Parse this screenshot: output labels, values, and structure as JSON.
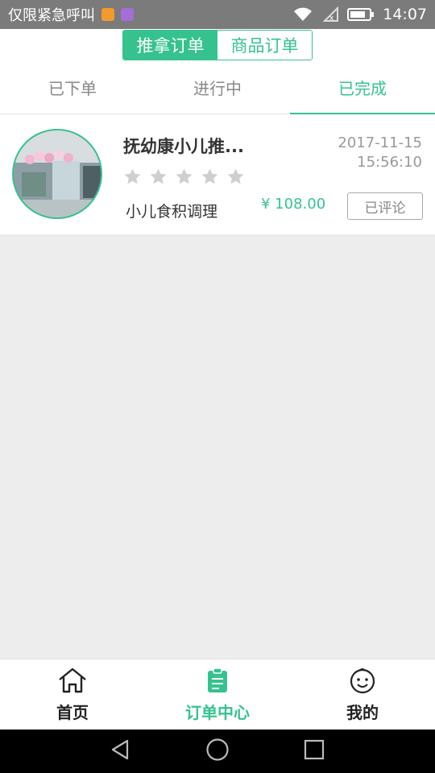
{
  "status_bar": {
    "carrier": "仅限紧急呼叫",
    "time": "14:07"
  },
  "header": {
    "segments": [
      {
        "label": "推拿订单",
        "active": true
      },
      {
        "label": "商品订单",
        "active": false
      }
    ]
  },
  "tabs": [
    {
      "label": "已下单",
      "active": false
    },
    {
      "label": "进行中",
      "active": false
    },
    {
      "label": "已完成",
      "active": true
    }
  ],
  "order": {
    "title": "抚幼康小儿推...",
    "date": "2017-11-15",
    "time": "15:56:10",
    "rating": 0,
    "rating_max": 5,
    "service": "小儿食积调理",
    "price": "¥ 108.00",
    "action_label": "已评论"
  },
  "bottom_nav": [
    {
      "label": "首页",
      "icon": "home-icon",
      "active": false
    },
    {
      "label": "订单中心",
      "icon": "clipboard-icon",
      "active": true
    },
    {
      "label": "我的",
      "icon": "baby-face-icon",
      "active": false
    }
  ],
  "colors": {
    "accent": "#35c28f",
    "status_bar": "#7b7b7b",
    "background": "#ededed"
  }
}
